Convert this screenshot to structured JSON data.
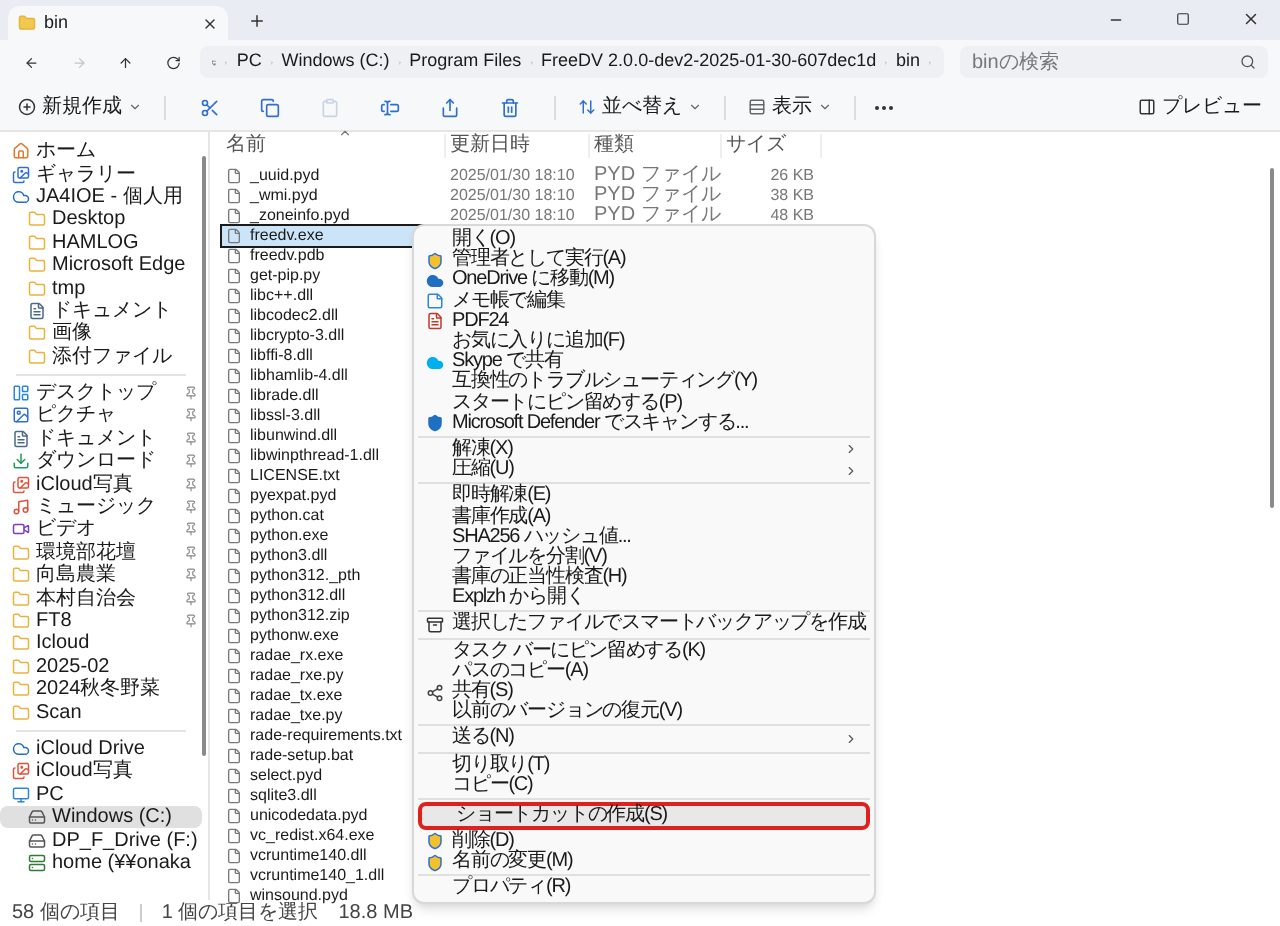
{
  "tab": {
    "title": "bin"
  },
  "nav": [
    {
      "kind": "back",
      "disabled": false
    },
    {
      "kind": "forward",
      "disabled": true
    },
    {
      "kind": "up",
      "disabled": false
    },
    {
      "kind": "refresh",
      "disabled": false
    }
  ],
  "address": {
    "crumbs": [
      "PC",
      "Windows (C:)",
      "Program Files",
      "FreeDV 2.0.0-dev2-2025-01-30-607dec1d",
      "bin"
    ]
  },
  "search": {
    "placeholder": "binの検索"
  },
  "toolbar": {
    "new_label": "新規作成",
    "tools": [
      {
        "kind": "cut",
        "disabled": false
      },
      {
        "kind": "copy",
        "disabled": false
      },
      {
        "kind": "paste",
        "disabled": true
      },
      {
        "kind": "rename",
        "disabled": false
      },
      {
        "kind": "share",
        "disabled": false
      },
      {
        "kind": "delete",
        "disabled": false
      }
    ],
    "sort_label": "並べ替え",
    "view_label": "表示",
    "preview_label": "プレビュー"
  },
  "sidebar": {
    "items": [
      {
        "kind": "home",
        "label": "ホーム",
        "pinned": false,
        "selected": false
      },
      {
        "kind": "gallery",
        "label": "ギャラリー",
        "pinned": false,
        "selected": false
      },
      {
        "kind": "cloud",
        "label": "JA4IOE - 個人用",
        "pinned": false,
        "selected": false,
        "children": [
          {
            "kind": "folder",
            "label": "Desktop",
            "pinned": false,
            "selected": false
          },
          {
            "kind": "folder",
            "label": "HAMLOG",
            "pinned": false,
            "selected": false
          },
          {
            "kind": "folder",
            "label": "Microsoft Edge",
            "pinned": false,
            "selected": false
          },
          {
            "kind": "folder",
            "label": "tmp",
            "pinned": false,
            "selected": false
          },
          {
            "kind": "docs",
            "label": "ドキュメント",
            "pinned": false,
            "selected": false
          },
          {
            "kind": "folder",
            "label": "画像",
            "pinned": false,
            "selected": false
          },
          {
            "kind": "folder",
            "label": "添付ファイル",
            "pinned": false,
            "selected": false
          }
        ]
      },
      {
        "kind": "separator"
      },
      {
        "kind": "desktop",
        "label": "デスクトップ",
        "pinned": true,
        "selected": false
      },
      {
        "kind": "pictures",
        "label": "ピクチャ",
        "pinned": true,
        "selected": false
      },
      {
        "kind": "docs",
        "label": "ドキュメント",
        "pinned": true,
        "selected": false
      },
      {
        "kind": "download",
        "label": "ダウンロード",
        "pinned": true,
        "selected": false
      },
      {
        "kind": "photos",
        "label": "iCloud写真",
        "pinned": true,
        "selected": false
      },
      {
        "kind": "music",
        "label": "ミュージック",
        "pinned": true,
        "selected": false
      },
      {
        "kind": "video",
        "label": "ビデオ",
        "pinned": true,
        "selected": false
      },
      {
        "kind": "folder",
        "label": "環境部花壇",
        "pinned": true,
        "selected": false
      },
      {
        "kind": "folder",
        "label": "向島農業",
        "pinned": true,
        "selected": false
      },
      {
        "kind": "folder",
        "label": "本村自治会",
        "pinned": true,
        "selected": false
      },
      {
        "kind": "folder",
        "label": "FT8",
        "pinned": true,
        "selected": false
      },
      {
        "kind": "folder",
        "label": "Icloud",
        "pinned": false,
        "selected": false
      },
      {
        "kind": "folder",
        "label": "2025-02",
        "pinned": false,
        "selected": false
      },
      {
        "kind": "folder",
        "label": "2024秋冬野菜",
        "pinned": false,
        "selected": false
      },
      {
        "kind": "folder",
        "label": "Scan",
        "pinned": false,
        "selected": false
      },
      {
        "kind": "separator"
      },
      {
        "kind": "cloud",
        "label": "iCloud Drive",
        "pinned": false,
        "selected": false
      },
      {
        "kind": "photos",
        "label": "iCloud写真",
        "pinned": false,
        "selected": false
      },
      {
        "kind": "pc",
        "label": "PC",
        "pinned": false,
        "selected": false,
        "children": [
          {
            "kind": "drive",
            "label": "Windows (C:)",
            "pinned": false,
            "selected": true
          },
          {
            "kind": "drive",
            "label": "DP_F_Drive (F:)",
            "pinned": false,
            "selected": false
          },
          {
            "kind": "network",
            "label": "home (¥¥onaka",
            "pinned": false,
            "selected": false
          }
        ]
      }
    ]
  },
  "columns": [
    "名前",
    "更新日時",
    "種類",
    "サイズ"
  ],
  "files": [
    {
      "name": "_uuid.pyd",
      "date": "2025/01/30 18:10",
      "type": "PYD ファイル",
      "size": "26 KB",
      "selected": false
    },
    {
      "name": "_wmi.pyd",
      "date": "2025/01/30 18:10",
      "type": "PYD ファイル",
      "size": "38 KB",
      "selected": false
    },
    {
      "name": "_zoneinfo.pyd",
      "date": "2025/01/30 18:10",
      "type": "PYD ファイル",
      "size": "48 KB",
      "selected": false
    },
    {
      "name": "freedv.exe",
      "selected": true
    },
    {
      "name": "freedv.pdb",
      "selected": false
    },
    {
      "name": "get-pip.py",
      "selected": false
    },
    {
      "name": "libc++.dll",
      "selected": false
    },
    {
      "name": "libcodec2.dll",
      "selected": false
    },
    {
      "name": "libcrypto-3.dll",
      "selected": false
    },
    {
      "name": "libffi-8.dll",
      "selected": false
    },
    {
      "name": "libhamlib-4.dll",
      "selected": false
    },
    {
      "name": "librade.dll",
      "selected": false
    },
    {
      "name": "libssl-3.dll",
      "selected": false
    },
    {
      "name": "libunwind.dll",
      "selected": false
    },
    {
      "name": "libwinpthread-1.dll",
      "selected": false
    },
    {
      "name": "LICENSE.txt",
      "selected": false
    },
    {
      "name": "pyexpat.pyd",
      "selected": false
    },
    {
      "name": "python.cat",
      "selected": false
    },
    {
      "name": "python.exe",
      "selected": false
    },
    {
      "name": "python3.dll",
      "selected": false
    },
    {
      "name": "python312._pth",
      "selected": false
    },
    {
      "name": "python312.dll",
      "selected": false
    },
    {
      "name": "python312.zip",
      "selected": false
    },
    {
      "name": "pythonw.exe",
      "selected": false
    },
    {
      "name": "radae_rx.exe",
      "selected": false
    },
    {
      "name": "radae_rxe.py",
      "selected": false
    },
    {
      "name": "radae_tx.exe",
      "selected": false
    },
    {
      "name": "radae_txe.py",
      "selected": false
    },
    {
      "name": "rade-requirements.txt",
      "selected": false
    },
    {
      "name": "rade-setup.bat",
      "selected": false
    },
    {
      "name": "select.pyd",
      "selected": false
    },
    {
      "name": "sqlite3.dll",
      "selected": false
    },
    {
      "name": "unicodedata.pyd",
      "selected": false
    },
    {
      "name": "vc_redist.x64.exe",
      "selected": false
    },
    {
      "name": "vcruntime140.dll",
      "selected": false
    },
    {
      "name": "vcruntime140_1.dll",
      "selected": false
    },
    {
      "name": "winsound.pyd",
      "selected": false
    }
  ],
  "context_menu": {
    "items": [
      {
        "kind": "plain",
        "label": "開く(O)",
        "submenu": false,
        "selected": false
      },
      {
        "kind": "shield",
        "label": "管理者として実行(A)",
        "submenu": false,
        "selected": false
      },
      {
        "kind": "cloud",
        "label": "OneDrive に移動(M)",
        "submenu": false,
        "selected": false
      },
      {
        "kind": "notepad",
        "label": "メモ帳で編集",
        "submenu": false,
        "selected": false
      },
      {
        "kind": "pdf",
        "label": "PDF24",
        "submenu": false,
        "selected": false
      },
      {
        "kind": "plain",
        "label": "お気に入りに追加(F)",
        "submenu": false,
        "selected": false
      },
      {
        "kind": "skype",
        "label": "Skype で共有",
        "submenu": false,
        "selected": false
      },
      {
        "kind": "plain",
        "label": "互換性のトラブルシューティング(Y)",
        "submenu": false,
        "selected": false
      },
      {
        "kind": "plain",
        "label": "スタートにピン留めする(P)",
        "submenu": false,
        "selected": false
      },
      {
        "kind": "defender",
        "label": "Microsoft Defender でスキャンする...",
        "submenu": false,
        "selected": false
      },
      {
        "kind": "separator"
      },
      {
        "kind": "plain",
        "label": "解凍(X)",
        "submenu": true,
        "selected": false
      },
      {
        "kind": "plain",
        "label": "圧縮(U)",
        "submenu": true,
        "selected": false
      },
      {
        "kind": "separator"
      },
      {
        "kind": "plain",
        "label": "即時解凍(E)",
        "submenu": false,
        "selected": false
      },
      {
        "kind": "plain",
        "label": "書庫作成(A)",
        "submenu": false,
        "selected": false
      },
      {
        "kind": "plain",
        "label": "SHA256 ハッシュ値...",
        "submenu": false,
        "selected": false
      },
      {
        "kind": "plain",
        "label": "ファイルを分割(V)",
        "submenu": false,
        "selected": false
      },
      {
        "kind": "plain",
        "label": "書庫の正当性検査(H)",
        "submenu": false,
        "selected": false
      },
      {
        "kind": "plain",
        "label": "Explzh から開く",
        "submenu": false,
        "selected": false
      },
      {
        "kind": "separator"
      },
      {
        "kind": "backup",
        "label": "選択したファイルでスマートバックアップを作成",
        "submenu": false,
        "selected": false
      },
      {
        "kind": "separator"
      },
      {
        "kind": "plain",
        "label": "タスク バーにピン留めする(K)",
        "submenu": false,
        "selected": false
      },
      {
        "kind": "plain",
        "label": "パスのコピー(A)",
        "submenu": false,
        "selected": false
      },
      {
        "kind": "share",
        "label": "共有(S)",
        "submenu": false,
        "selected": false
      },
      {
        "kind": "plain",
        "label": "以前のバージョンの復元(V)",
        "submenu": false,
        "selected": false
      },
      {
        "kind": "separator"
      },
      {
        "kind": "plain",
        "label": "送る(N)",
        "submenu": true,
        "selected": false
      },
      {
        "kind": "separator"
      },
      {
        "kind": "plain",
        "label": "切り取り(T)",
        "submenu": false,
        "selected": false
      },
      {
        "kind": "plain",
        "label": "コピー(C)",
        "submenu": false,
        "selected": false
      },
      {
        "kind": "separator"
      },
      {
        "kind": "plain",
        "label": "ショートカットの作成(S)",
        "submenu": false,
        "selected": true
      },
      {
        "kind": "shield",
        "label": "削除(D)",
        "submenu": false,
        "selected": false
      },
      {
        "kind": "shield",
        "label": "名前の変更(M)",
        "submenu": false,
        "selected": false
      },
      {
        "kind": "separator"
      },
      {
        "kind": "plain",
        "label": "プロパティ(R)",
        "submenu": false,
        "selected": false
      }
    ]
  },
  "status_bar": {
    "count": "58 個の項目",
    "selection": "1 個の項目を選択",
    "size": "18.8 MB"
  }
}
